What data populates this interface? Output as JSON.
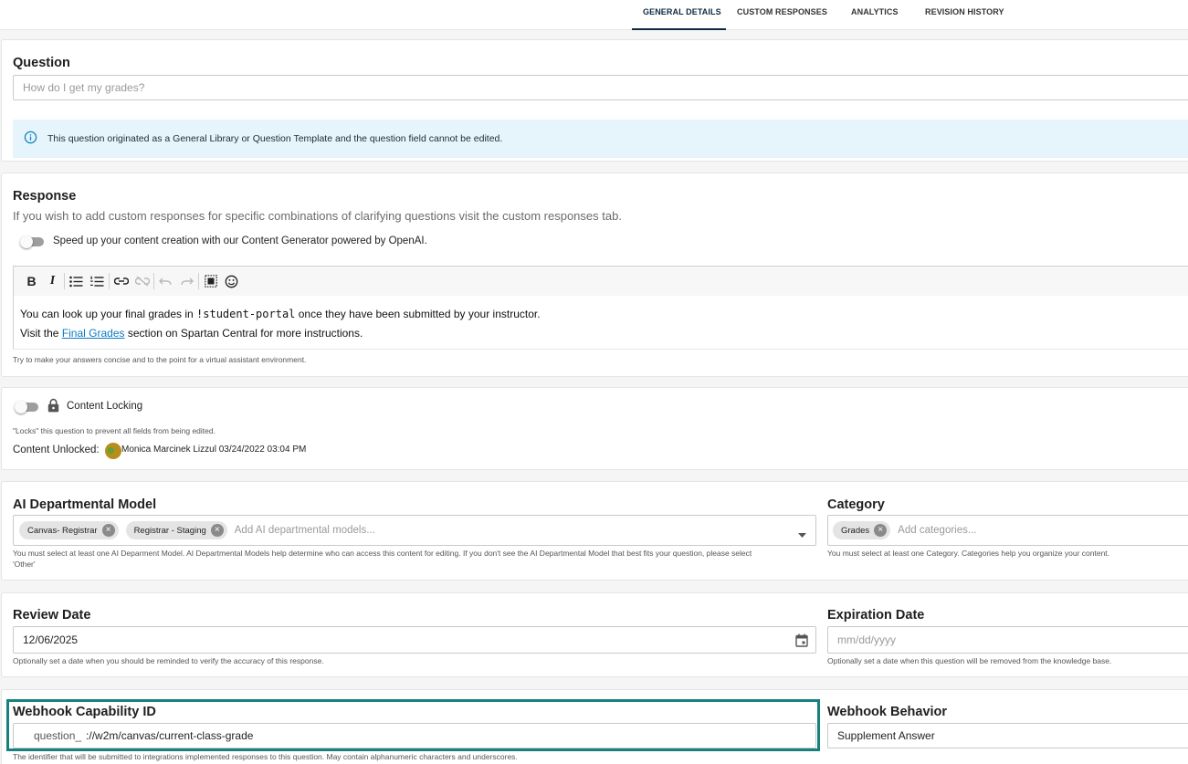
{
  "tabs": [
    {
      "label": "GENERAL DETAILS",
      "active": true
    },
    {
      "label": "CUSTOM RESPONSES",
      "active": false
    },
    {
      "label": "ANALYTICS",
      "active": false
    },
    {
      "label": "REVISION HISTORY",
      "active": false
    }
  ],
  "question": {
    "title": "Question",
    "value": "How do I get my grades?",
    "info_icon": "info-circle-icon",
    "info_text": "This question originated as a General Library or Question Template and the question field cannot be edited."
  },
  "response": {
    "title": "Response",
    "subtitle": "If you wish to add custom responses for specific combinations of clarifying questions visit the custom responses tab.",
    "generator_toggle_label": "Speed up your content creation with our Content Generator powered by OpenAI.",
    "generator_enabled": false,
    "toolbar_icons": [
      "bold-icon",
      "italic-icon",
      "bullet-list-icon",
      "numbered-list-icon",
      "link-icon",
      "unlink-icon",
      "undo-icon",
      "redo-icon",
      "select-all-icon",
      "emoji-icon"
    ],
    "line1_before": "You can look up your final grades in ",
    "line1_code": "!student-portal",
    "line1_after": " once they have been submitted by your instructor.",
    "line2_before": "Visit the ",
    "line2_link": "Final Grades",
    "line2_after": " section on Spartan Central for more instructions.",
    "help": "Try to make your answers concise and to the point for a virtual assistant environment."
  },
  "locking": {
    "label": "Content Locking",
    "enabled": false,
    "help": "\"Locks\" this question to prevent all fields from being edited.",
    "status_label": "Content Unlocked:",
    "status_user": "Monica Marcinek Lizzul 03/24/2022 03:04 PM"
  },
  "ai_model": {
    "title": "AI Departmental Model",
    "chips": [
      "Canvas- Registrar",
      "Registrar - Staging"
    ],
    "placeholder": "Add AI departmental models...",
    "help_line1": "You must select at least one AI Deparment Model. AI Departmental Models help determine who can access this content for editing. If you don't see the AI Departmental Model that best fits your question, please select",
    "help_line2": "'Other'"
  },
  "category": {
    "title": "Category",
    "chips": [
      "Grades"
    ],
    "placeholder": "Add categories...",
    "help": "You must select at least one Category. Categories help you organize your content."
  },
  "review_date": {
    "title": "Review Date",
    "value": "12/06/2025",
    "help": "Optionally set a date when you should be reminded to verify the accuracy of this response."
  },
  "expiration_date": {
    "title": "Expiration Date",
    "placeholder": "mm/dd/yyyy",
    "help": "Optionally set a date when this question will be removed from the knowledge base."
  },
  "webhook": {
    "title": "Webhook Capability ID",
    "prefix": "question_",
    "value": "://w2m/canvas/current-class-grade",
    "help": "The identifier that will be submitted to integrations implemented responses to this question. May contain alphanumeric characters and underscores.",
    "highlight_color": "#16817d"
  },
  "webhook_behavior": {
    "title": "Webhook Behavior",
    "value": "Supplement Answer"
  }
}
